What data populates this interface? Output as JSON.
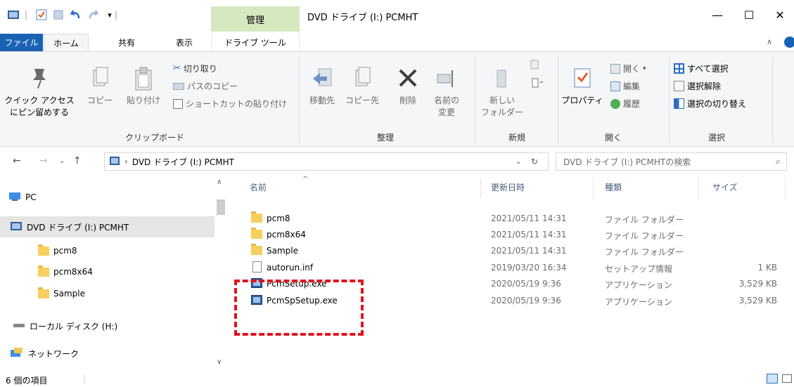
{
  "title_bar": {
    "manage_tab": "管理",
    "window_title": "DVD ドライブ (I:) PCMHT",
    "minimize_glyph": "—",
    "maximize_glyph": "☐",
    "close_glyph": "✕"
  },
  "ribbon_tabs": {
    "file": "ファイル",
    "home": "ホーム",
    "share": "共有",
    "view": "表示",
    "drive_tools": "ドライブ ツール"
  },
  "ribbon": {
    "clipboard": {
      "pin_label_line1": "クイック アクセス",
      "pin_label_line2": "にピン留めする",
      "copy": "コピー",
      "paste": "貼り付け",
      "cut": "切り取り",
      "copy_path": "パスのコピー",
      "paste_shortcut": "ショートカットの貼り付け",
      "group_label": "クリップボード"
    },
    "organize": {
      "move_to": "移動先",
      "copy_to": "コピー先",
      "delete": "削除",
      "rename_line1": "名前の",
      "rename_line2": "変更",
      "group_label": "整理"
    },
    "new": {
      "new_folder_line1": "新しい",
      "new_folder_line2": "フォルダー",
      "group_label": "新規"
    },
    "open": {
      "properties": "プロパティ",
      "open": "開く",
      "edit": "編集",
      "history": "履歴",
      "group_label": "開く"
    },
    "select": {
      "select_all": "すべて選択",
      "select_none": "選択解除",
      "invert_selection": "選択の切り替え",
      "group_label": "選択"
    }
  },
  "address_bar": {
    "path": "DVD ドライブ (I:) PCMHT",
    "search_placeholder": "DVD ドライブ (I:) PCMHTの検索"
  },
  "nav_pane": {
    "items": [
      {
        "label": "PC",
        "icon": "pc-icon"
      },
      {
        "label": "DVD ドライブ (I:) PCMHT",
        "icon": "dvd-drive-icon"
      },
      {
        "label": "pcm8",
        "icon": "folder-icon"
      },
      {
        "label": "pcm8x64",
        "icon": "folder-icon"
      },
      {
        "label": "Sample",
        "icon": "folder-icon"
      },
      {
        "label": "ローカル ディスク (H:)",
        "icon": "disk-icon"
      },
      {
        "label": "ネットワーク",
        "icon": "network-icon"
      }
    ]
  },
  "file_list": {
    "columns": [
      "名前",
      "更新日時",
      "種類",
      "サイズ"
    ],
    "rows": [
      {
        "name": "pcm8",
        "date": "2021/05/11 14:31",
        "type": "ファイル フォルダー",
        "size": "",
        "icon": "folder-icon"
      },
      {
        "name": "pcm8x64",
        "date": "2021/05/11 14:31",
        "type": "ファイル フォルダー",
        "size": "",
        "icon": "folder-icon"
      },
      {
        "name": "Sample",
        "date": "2021/05/11 14:31",
        "type": "ファイル フォルダー",
        "size": "",
        "icon": "folder-icon"
      },
      {
        "name": "autorun.inf",
        "date": "2019/03/20 16:34",
        "type": "セットアップ情報",
        "size": "1 KB",
        "icon": "setup-info-icon"
      },
      {
        "name": "PcmSetup.exe",
        "date": "2020/05/19 9:36",
        "type": "アプリケーション",
        "size": "3,529 KB",
        "icon": "application-icon"
      },
      {
        "name": "PcmSpSetup.exe",
        "date": "2020/05/19 9:36",
        "type": "アプリケーション",
        "size": "3,529 KB",
        "icon": "application-icon"
      }
    ]
  },
  "status_bar": {
    "item_count": "6 個の項目"
  },
  "colors": {
    "file_tab": "#1a63b4",
    "manage_tab": "#d5e8c0",
    "highlight_box": "#e0141e",
    "nav_selected": "#e5e5e5"
  }
}
